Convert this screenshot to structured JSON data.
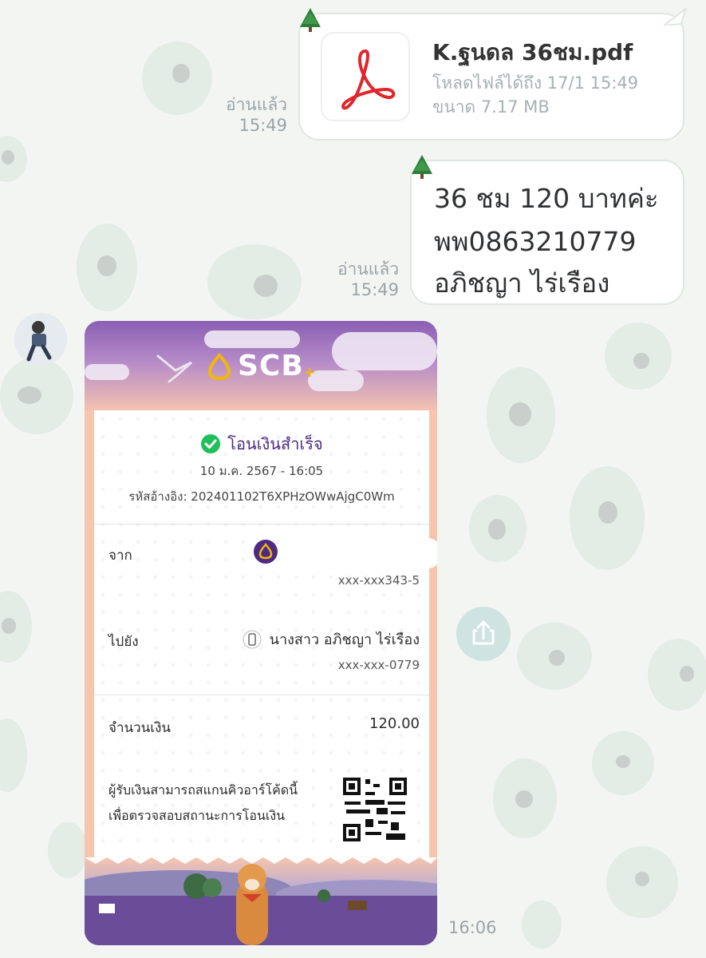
{
  "messages": {
    "file": {
      "name": "K.ฐนดล 36ชม.pdf",
      "download_until": "โหลดไฟล์ได้ถึง 17/1 15:49",
      "size": "ขนาด 7.17 MB",
      "read_label": "อ่านแล้ว",
      "read_time": "15:49"
    },
    "text": {
      "lines": [
        "36 ชม 120 บาทค่ะ",
        "พพ0863210779",
        "อภิชญา ไร่เรือง"
      ],
      "read_label": "อ่านแล้ว",
      "read_time": "15:49"
    },
    "slip": {
      "bank": "SCB",
      "status": "โอนเงินสำเร็จ",
      "datetime": "10 ม.ค. 2567 - 16:05",
      "reference": "รหัสอ้างอิง: 202401102T6XPHzOWwAjgC0Wm",
      "from_label": "จาก",
      "from_account": "xxx-xxx343-5",
      "to_label": "ไปยัง",
      "to_name": "นางสาว อภิชญา ไร่เรือง",
      "to_account": "xxx-xxx-0779",
      "amount_label": "จำนวนเงิน",
      "amount": "120.00",
      "qr_note_1": "ผู้รับเงินสามารถสแกนคิวอาร์โค้ดนี้",
      "qr_note_2": "เพื่อตรวจสอบสถานะการโอนเงิน",
      "time": "16:06"
    }
  },
  "icons": {
    "file": "pdf-icon",
    "status": "check-circle-icon",
    "share": "share-icon",
    "phone": "phone-icon"
  },
  "colors": {
    "pdf_red": "#e0262b",
    "success_green": "#1fbf5a",
    "scb_purple": "#4e2a84",
    "scb_gold": "#f2b705",
    "bubble_border": "#dfe7e2"
  }
}
